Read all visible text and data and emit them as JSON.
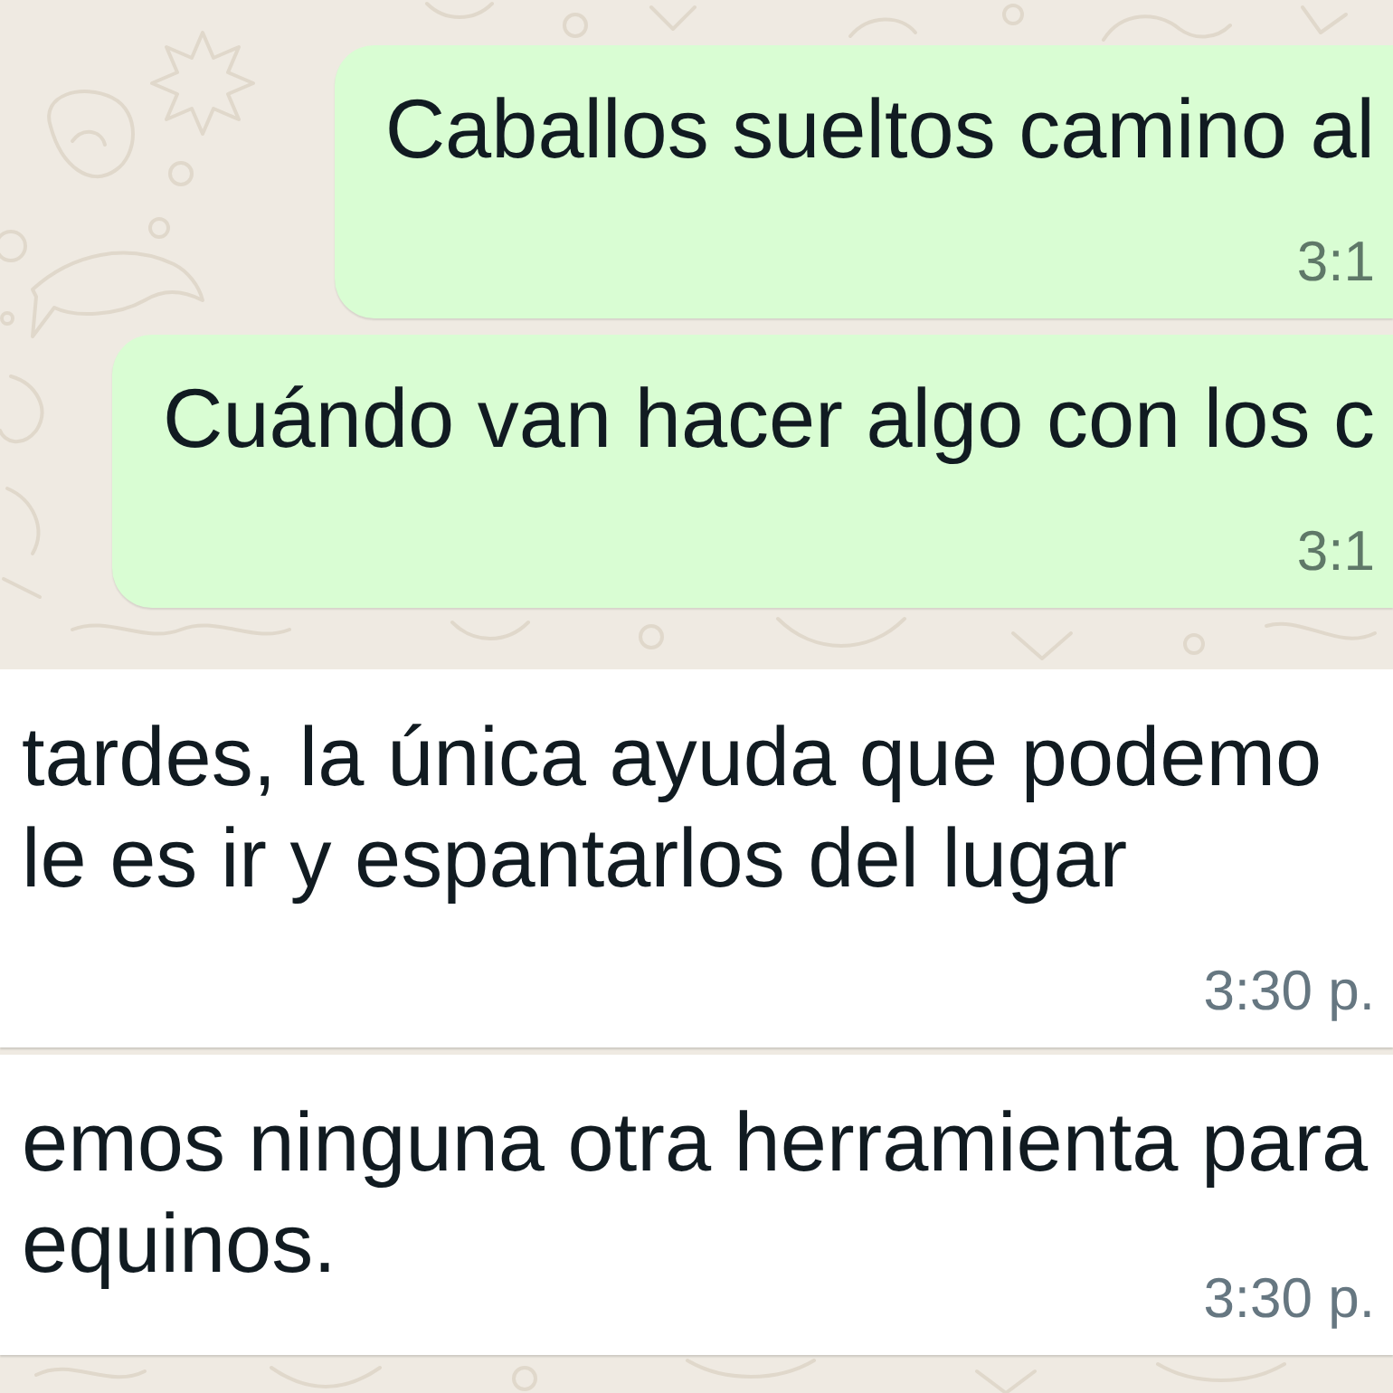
{
  "messages": [
    {
      "kind": "outgoing",
      "lines": [
        "Caballos sueltos camino al"
      ],
      "time": "3:1"
    },
    {
      "kind": "outgoing",
      "lines": [
        "Cuándo van hacer algo con los c"
      ],
      "time": "3:1"
    },
    {
      "kind": "incoming",
      "lines": [
        "tardes, la única ayuda que podemo",
        "le es ir y espantarlos del lugar"
      ],
      "time": "3:30 p."
    },
    {
      "kind": "incoming",
      "lines": [
        "emos ninguna otra herramienta para",
        "equinos."
      ],
      "time": "3:30 p."
    }
  ]
}
